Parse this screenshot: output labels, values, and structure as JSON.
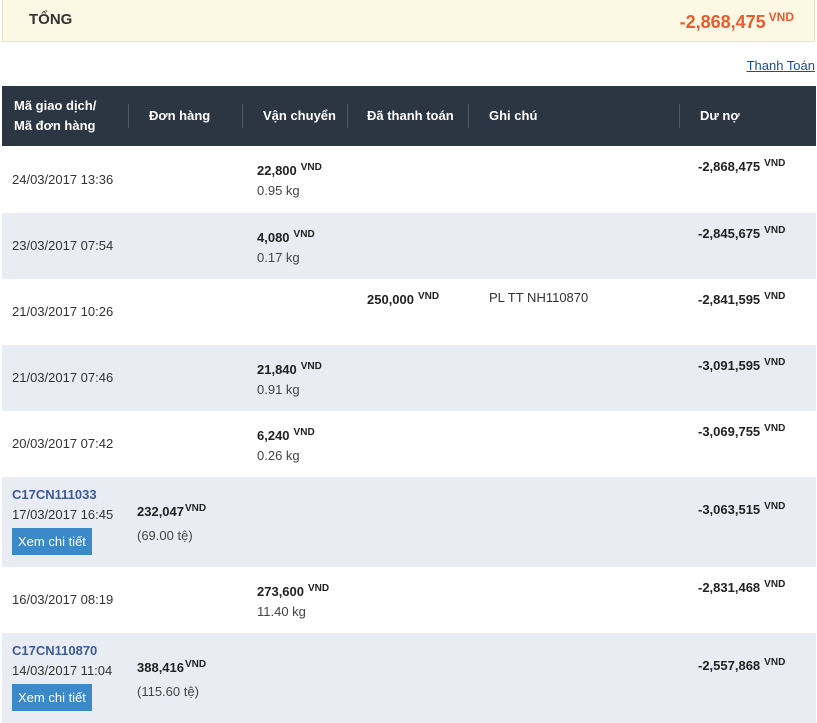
{
  "summary": {
    "label": "TỔNG",
    "amount": "-2,868,475",
    "currency": "VND"
  },
  "actions": {
    "pay_link": "Thanh Toán"
  },
  "table": {
    "headers": {
      "txn_line1": "Mã giao dịch/",
      "txn_line2": "Mã đơn hàng",
      "order": "Đơn hàng",
      "shipping": "Vận chuyển",
      "paid": "Đã thanh toán",
      "note": "Ghi chú",
      "balance": "Dư nợ"
    },
    "currency": "VND",
    "detail_button": "Xem chi tiết",
    "rows": [
      {
        "date": "24/03/2017 13:36",
        "shipping": "22,800",
        "weight": "0.95 kg",
        "balance": "-2,868,475"
      },
      {
        "date": "23/03/2017 07:54",
        "shipping": "4,080",
        "weight": "0.17 kg",
        "balance": "-2,845,675"
      },
      {
        "date": "21/03/2017 10:26",
        "paid": "250,000",
        "note": "PL TT NH110870",
        "balance": "-2,841,595"
      },
      {
        "date": "21/03/2017 07:46",
        "shipping": "21,840",
        "weight": "0.91 kg",
        "balance": "-3,091,595"
      },
      {
        "date": "20/03/2017 07:42",
        "shipping": "6,240",
        "weight": "0.26 kg",
        "balance": "-3,069,755"
      },
      {
        "code": "C17CN111033",
        "date": "17/03/2017 16:45",
        "order": "232,047",
        "order_sub": "(69.00 tệ)",
        "balance": "-3,063,515"
      },
      {
        "date": "16/03/2017 08:19",
        "shipping": "273,600",
        "weight": "11.40 kg",
        "balance": "-2,831,468"
      },
      {
        "code": "C17CN110870",
        "date": "14/03/2017 11:04",
        "order": "388,416",
        "order_sub": "(115.60 tệ)",
        "balance": "-2,557,868"
      }
    ]
  }
}
